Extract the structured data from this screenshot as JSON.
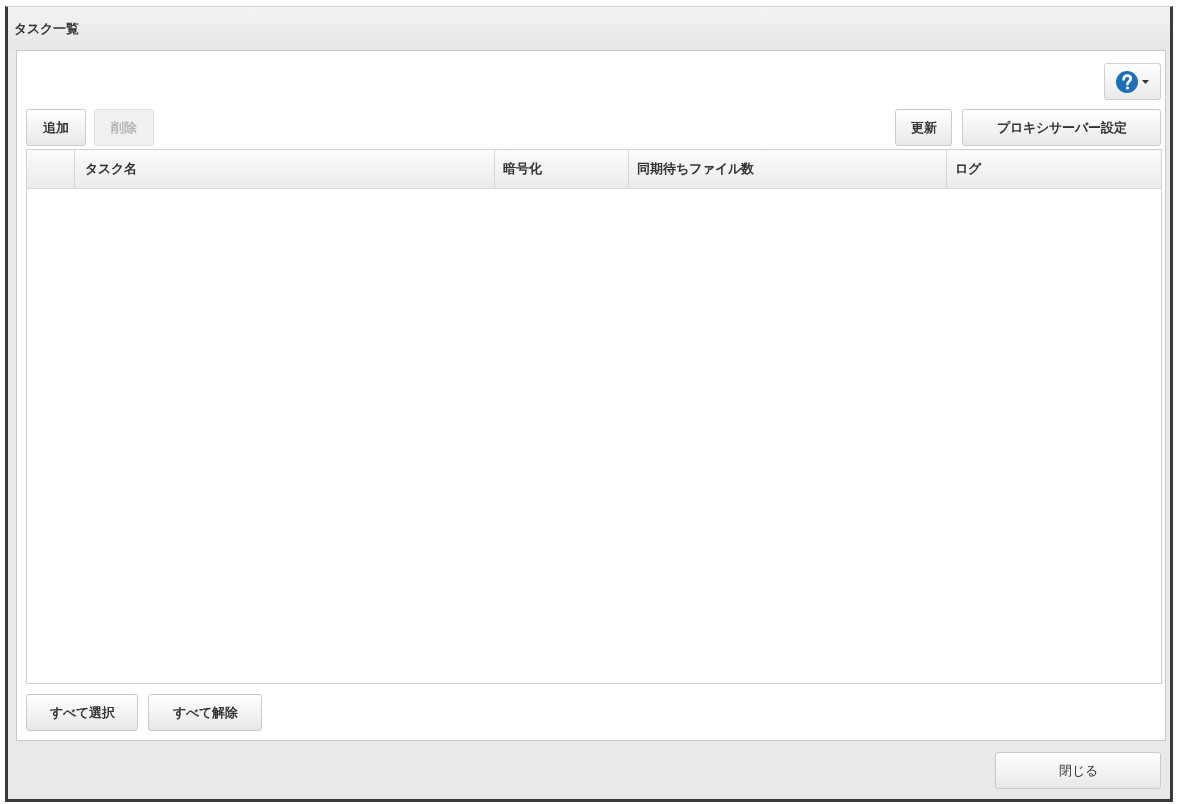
{
  "window": {
    "title": "タスク一覧"
  },
  "toolbar": {
    "left_buttons": [
      {
        "label": "追加",
        "disabled": false
      },
      {
        "label": "削除",
        "disabled": true
      }
    ],
    "right_buttons": [
      {
        "label": "更新",
        "disabled": false
      },
      {
        "label": "プロキシサーバー設定",
        "disabled": false
      }
    ]
  },
  "table": {
    "columns": [
      {
        "label": "タスク名"
      },
      {
        "label": "暗号化"
      },
      {
        "label": "同期待ちファイル数"
      },
      {
        "label": "ログ"
      }
    ]
  },
  "selection_buttons": [
    {
      "label": "すべて選択"
    },
    {
      "label": "すべて解除"
    }
  ],
  "footer": {
    "buttons": [
      {
        "label": "閉じる"
      }
    ]
  }
}
